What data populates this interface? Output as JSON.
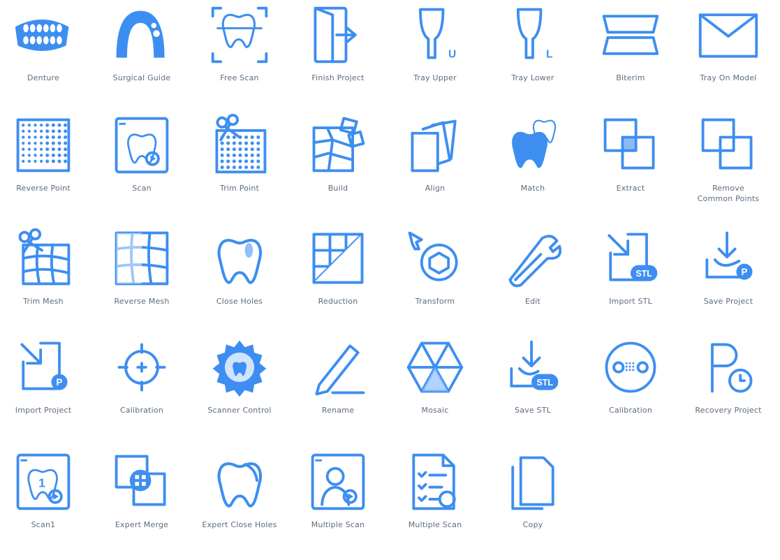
{
  "colors": {
    "primary": "#3d8ef0",
    "light": "#cfe4ff",
    "mid": "#8ec0ff",
    "label": "#5c6c80"
  },
  "tiles": [
    {
      "label": "Denture",
      "icon": "denture-icon"
    },
    {
      "label": "Surgical Guide",
      "icon": "surgical-guide-icon"
    },
    {
      "label": "Free Scan",
      "icon": "free-scan-icon"
    },
    {
      "label": "Finish Project",
      "icon": "finish-project-icon"
    },
    {
      "label": "Tray Upper",
      "icon": "tray-upper-icon"
    },
    {
      "label": "Tray Lower",
      "icon": "tray-lower-icon"
    },
    {
      "label": "Biterim",
      "icon": "biterim-icon"
    },
    {
      "label": "Tray On Model",
      "icon": "tray-on-model-icon"
    },
    {
      "label": "Reverse Point",
      "icon": "reverse-point-icon"
    },
    {
      "label": "Scan",
      "icon": "scan-icon"
    },
    {
      "label": "Trim Point",
      "icon": "trim-point-icon"
    },
    {
      "label": "Build",
      "icon": "build-icon"
    },
    {
      "label": "Align",
      "icon": "align-icon"
    },
    {
      "label": "Match",
      "icon": "match-icon"
    },
    {
      "label": "Extract",
      "icon": "extract-icon"
    },
    {
      "label": "Remove\nCommon Points",
      "icon": "remove-common-points-icon"
    },
    {
      "label": "Trim Mesh",
      "icon": "trim-mesh-icon"
    },
    {
      "label": "Reverse Mesh",
      "icon": "reverse-mesh-icon"
    },
    {
      "label": "Close Holes",
      "icon": "close-holes-icon"
    },
    {
      "label": "Reduction",
      "icon": "reduction-icon"
    },
    {
      "label": "Transform",
      "icon": "transform-icon"
    },
    {
      "label": "Edit",
      "icon": "edit-icon"
    },
    {
      "label": "Import STL",
      "icon": "import-stl-icon"
    },
    {
      "label": "Save Project",
      "icon": "save-project-icon"
    },
    {
      "label": "Import Project",
      "icon": "import-project-icon"
    },
    {
      "label": "Calibration",
      "icon": "calibration-crosshair-icon"
    },
    {
      "label": "Scanner Control",
      "icon": "scanner-control-icon"
    },
    {
      "label": "Rename",
      "icon": "rename-icon"
    },
    {
      "label": "Mosaic",
      "icon": "mosaic-icon"
    },
    {
      "label": "Save STL",
      "icon": "save-stl-icon"
    },
    {
      "label": "Calibration",
      "icon": "calibration-board-icon"
    },
    {
      "label": "Recovery Project",
      "icon": "recovery-project-icon"
    },
    {
      "label": "Scan1",
      "icon": "scan1-icon"
    },
    {
      "label": "Expert Merge",
      "icon": "expert-merge-icon"
    },
    {
      "label": "Expert Close Holes",
      "icon": "expert-close-holes-icon"
    },
    {
      "label": "Multiple Scan",
      "icon": "multiple-scan-person-icon"
    },
    {
      "label": "Multiple Scan",
      "icon": "multiple-scan-list-icon"
    },
    {
      "label": "Copy",
      "icon": "copy-icon"
    }
  ]
}
